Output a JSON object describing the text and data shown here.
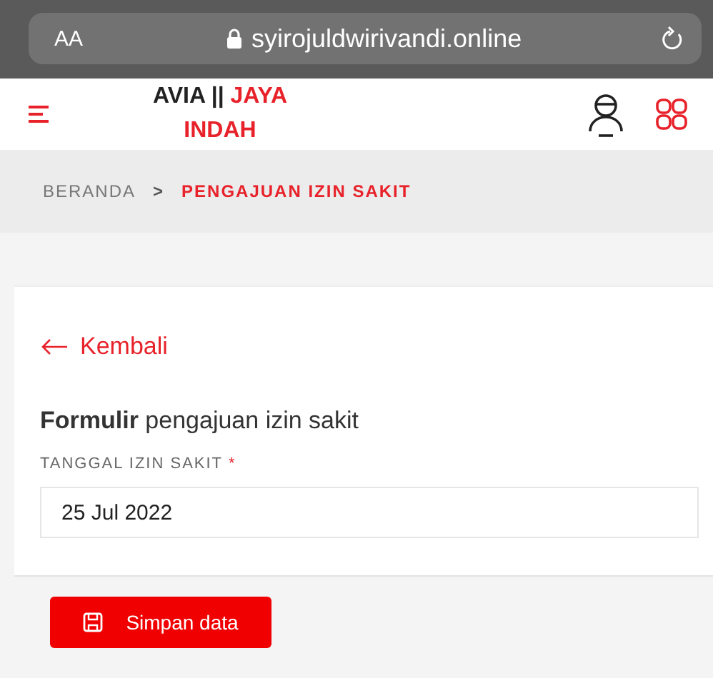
{
  "browser": {
    "text_size": "AA",
    "url": "syirojuldwirivandi.online"
  },
  "header": {
    "brand_prefix": "AVIA ||",
    "brand_highlight": "JAYA INDAH"
  },
  "breadcrumb": {
    "separator": ">",
    "items": [
      {
        "label": "BERANDA",
        "selected": false
      },
      {
        "label": "PENGAJUAN IZIN SAKIT",
        "selected": true
      }
    ]
  },
  "back_link": "Kembali",
  "form": {
    "title": "**Formulir** pengajuan izin sakit",
    "field_label": "TANGGAL IZIN SAKIT",
    "required_mark": "*",
    "field_value": "25 Jul 2022"
  },
  "buttons": [
    "Simpan data"
  ]
}
